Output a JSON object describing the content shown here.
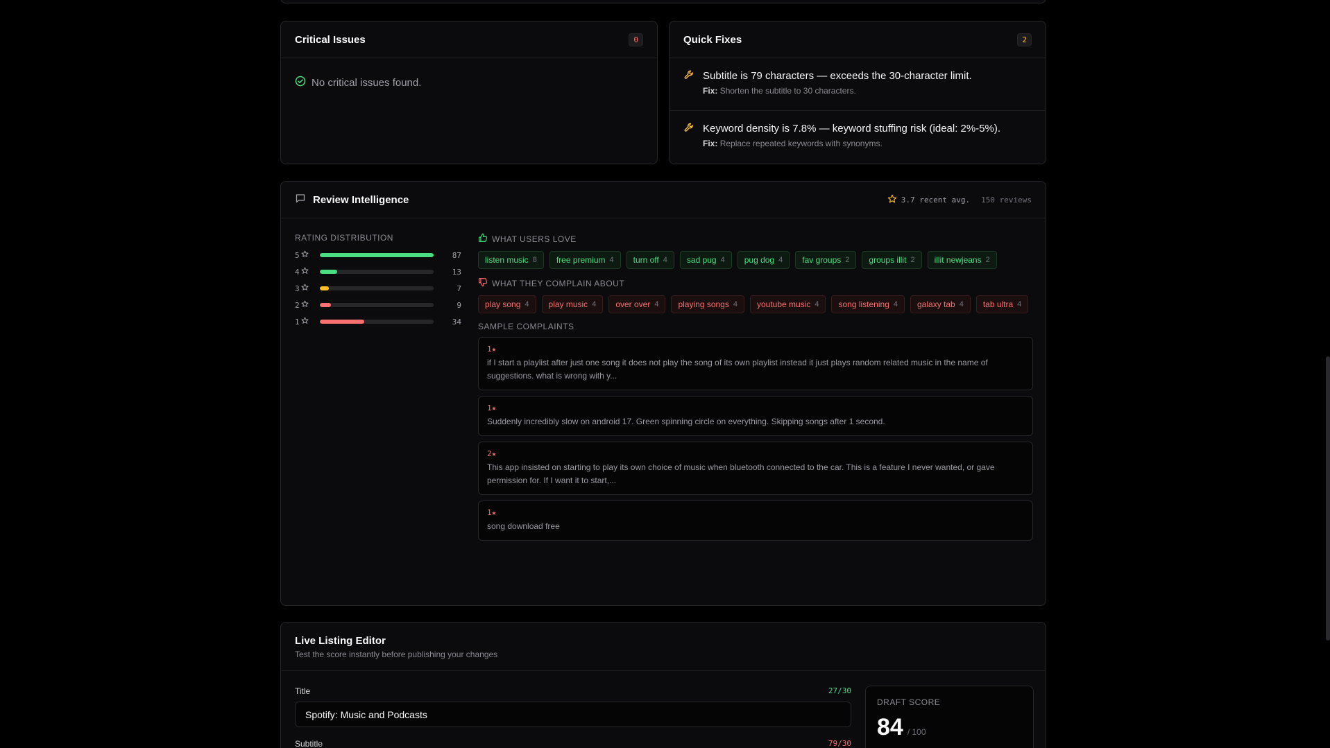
{
  "critical": {
    "title": "Critical Issues",
    "count": "0",
    "empty_message": "No critical issues found."
  },
  "quick_fixes": {
    "title": "Quick Fixes",
    "count": "2",
    "items": [
      {
        "issue": "Subtitle is 79 characters — exceeds the 30-character limit.",
        "fix_label": "Fix:",
        "fix": "Shorten the subtitle to 30 characters."
      },
      {
        "issue": "Keyword density is 7.8% — keyword stuffing risk (ideal: 2%-5%).",
        "fix_label": "Fix:",
        "fix": "Replace repeated keywords with synonyms."
      }
    ]
  },
  "review": {
    "title": "Review Intelligence",
    "avg": "3.7 recent avg.",
    "reviews": "150 reviews",
    "distribution_label": "RATING DISTRIBUTION",
    "distribution": [
      {
        "star": "5",
        "count": "87",
        "fraction": 1.0,
        "color": "#4ade80"
      },
      {
        "star": "4",
        "count": "13",
        "fraction": 0.15,
        "color": "#4ade80"
      },
      {
        "star": "3",
        "count": "7",
        "fraction": 0.08,
        "color": "#fbbf24"
      },
      {
        "star": "2",
        "count": "9",
        "fraction": 0.1,
        "color": "#f87171"
      },
      {
        "star": "1",
        "count": "34",
        "fraction": 0.39,
        "color": "#f87171"
      }
    ],
    "love_label": "WHAT USERS LOVE",
    "love": [
      {
        "term": "listen music",
        "n": "8"
      },
      {
        "term": "free premium",
        "n": "4"
      },
      {
        "term": "turn off",
        "n": "4"
      },
      {
        "term": "sad pug",
        "n": "4"
      },
      {
        "term": "pug dog",
        "n": "4"
      },
      {
        "term": "fav groups",
        "n": "2"
      },
      {
        "term": "groups illit",
        "n": "2"
      },
      {
        "term": "illit newjeans",
        "n": "2"
      }
    ],
    "complain_label": "WHAT THEY COMPLAIN ABOUT",
    "complain": [
      {
        "term": "play song",
        "n": "4"
      },
      {
        "term": "play music",
        "n": "4"
      },
      {
        "term": "over over",
        "n": "4"
      },
      {
        "term": "playing songs",
        "n": "4"
      },
      {
        "term": "youtube music",
        "n": "4"
      },
      {
        "term": "song listening",
        "n": "4"
      },
      {
        "term": "galaxy tab",
        "n": "4"
      },
      {
        "term": "tab ultra",
        "n": "4"
      }
    ],
    "samples_label": "SAMPLE COMPLAINTS",
    "samples": [
      {
        "rating": "1★",
        "text": "if I start a playlist after just one song it does not play the song of its own playlist instead it just plays random related music in the name of suggestions. what is wrong with y..."
      },
      {
        "rating": "1★",
        "text": "Suddenly incredibly slow on android 17. Green spinning circle on everything. Skipping songs after 1 second."
      },
      {
        "rating": "2★",
        "text": "This app insisted on starting to play its own choice of music when bluetooth connected to the car. This is a feature I never wanted, or gave permission for. If I want it to start,..."
      },
      {
        "rating": "1★",
        "text": "song download free"
      }
    ]
  },
  "editor": {
    "title": "Live Listing Editor",
    "subtitle": "Test the score instantly before publishing your changes",
    "title_label": "Title",
    "title_count": "27/30",
    "title_value": "Spotify: Music and Podcasts",
    "subtitle_label": "Subtitle",
    "subtitle_count": "79/30",
    "draft_label": "DRAFT SCORE",
    "draft_score": "84",
    "draft_of": "/ 100"
  },
  "colors": {
    "ok": "#4ade80",
    "warn": "#fbbf24",
    "bad": "#f87171",
    "wrench": "#f5b942"
  }
}
